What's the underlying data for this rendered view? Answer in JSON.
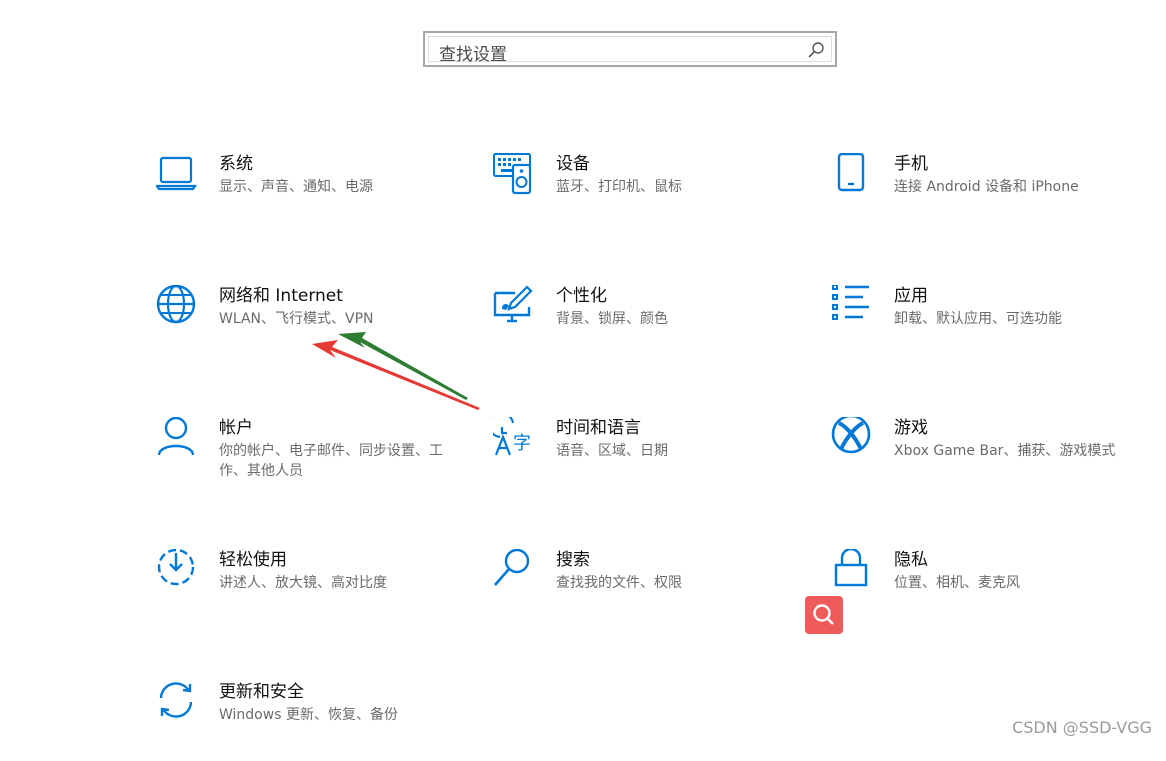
{
  "search": {
    "placeholder": "查找设置"
  },
  "tiles": [
    {
      "title": "系统",
      "desc": "显示、声音、通知、电源",
      "icon": "laptop-icon"
    },
    {
      "title": "设备",
      "desc": "蓝牙、打印机、鼠标",
      "icon": "devices-icon"
    },
    {
      "title": "手机",
      "desc": "连接 Android 设备和 iPhone",
      "icon": "phone-icon"
    },
    {
      "title": "网络和 Internet",
      "desc": "WLAN、飞行模式、VPN",
      "icon": "globe-icon"
    },
    {
      "title": "个性化",
      "desc": "背景、锁屏、颜色",
      "icon": "personalization-icon"
    },
    {
      "title": "应用",
      "desc": "卸载、默认应用、可选功能",
      "icon": "apps-list-icon"
    },
    {
      "title": "帐户",
      "desc": "你的帐户、电子邮件、同步设置、工作、其他人员",
      "icon": "person-icon"
    },
    {
      "title": "时间和语言",
      "desc": "语音、区域、日期",
      "icon": "time-language-icon"
    },
    {
      "title": "游戏",
      "desc": "Xbox Game Bar、捕获、游戏模式",
      "icon": "xbox-icon"
    },
    {
      "title": "轻松使用",
      "desc": "讲述人、放大镜、高对比度",
      "icon": "ease-of-access-icon"
    },
    {
      "title": "搜索",
      "desc": "查找我的文件、权限",
      "icon": "search-icon"
    },
    {
      "title": "隐私",
      "desc": "位置、相机、麦克风",
      "icon": "lock-icon"
    },
    {
      "title": "更新和安全",
      "desc": "Windows 更新、恢复、备份",
      "icon": "sync-icon"
    }
  ],
  "watermark": "CSDN @SSD-VGG",
  "colors": {
    "accent": "#0078d7",
    "arrow_red": "#e53935",
    "arrow_green": "#2e7d32",
    "fab": "#ef5a5a"
  }
}
